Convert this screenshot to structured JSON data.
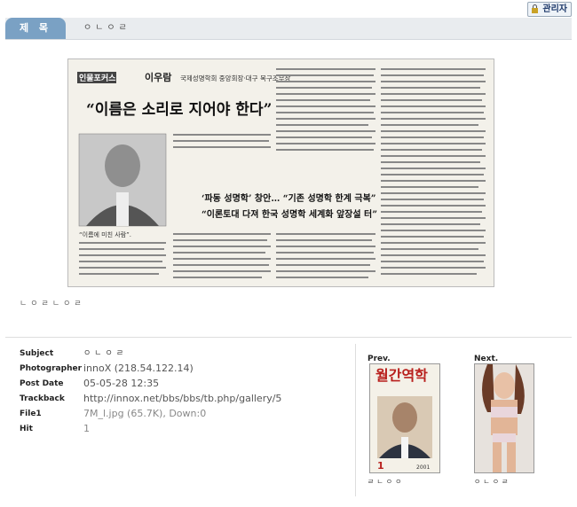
{
  "admin": {
    "label": "관리자"
  },
  "header": {
    "tab_label": "제 목",
    "title": "ㅇㄴㅇㄹ"
  },
  "article": {
    "section_tag": "인물포커스",
    "name": "이우람",
    "affiliation": "국제성명학회 중앙회장·대구 복구조무장",
    "headline": "“이름은 소리로 지어야 한다”",
    "sub1": "‘파동 성명학’ 창안… “기존 성명학 한계 극복”",
    "sub2": "“이론토대 다져 한국 성명학 세계화 앞장설 터”",
    "photo_caption": "“이름에 미친 사람”."
  },
  "image_caption": "ㄴㅇㄹㄴㅇㄹ",
  "info": {
    "subject_label": "Subject",
    "subject": "ㅇㄴㅇㄹ",
    "photographer_label": "Photographer",
    "photographer": "innoX (218.54.122.14)",
    "post_date_label": "Post Date",
    "post_date": "05-05-28 12:35",
    "trackback_label": "Trackback",
    "trackback": "http://innox.net/bbs/bbs/tb.php/gallery/5",
    "file_label": "File1",
    "file": "7M_l.jpg (65.7K), Down:0",
    "hit_label": "Hit",
    "hit": "1"
  },
  "prev": {
    "label": "Prev.",
    "magazine_title": "월간역학",
    "issue": "1",
    "year": "2001",
    "caption": "ㄹㄴㅇㅇ"
  },
  "next": {
    "label": "Next.",
    "caption": "ㅇㄴㅇㄹ"
  }
}
